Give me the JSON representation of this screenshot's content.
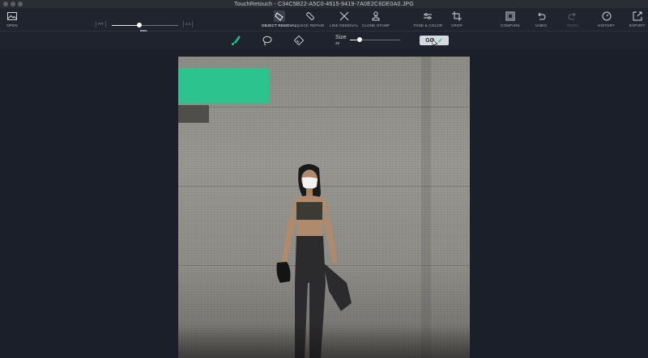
{
  "window": {
    "title": "TouchRetouch - C34C5B22-A5C0-4615-9419-7A0E2C6DE0A0.JPG"
  },
  "toolbar": {
    "open": "OPEN",
    "fit": "FIT",
    "one_to_one": "1:1",
    "zoom_value": "89%",
    "zoom_fraction": 0.42,
    "object_removal": "OBJECT REMOVAL",
    "quick_repair": "QUICK REPAIR",
    "line_removal": "LINE REMOVAL",
    "clone_stamp": "CLONE STAMP",
    "tone_color": "TONE & COLOR",
    "crop": "CROP",
    "compare": "COMPARE",
    "undo": "UNDO",
    "redo": "REDO",
    "history": "HISTORY",
    "export": "EXPORT"
  },
  "subbar": {
    "size_label": "Size",
    "size_value": "25",
    "size_fraction": 0.2,
    "go_label": "GO"
  },
  "colors": {
    "accent": "#27c68f",
    "background": "#1b1f2a",
    "toolbar": "#20242e"
  }
}
